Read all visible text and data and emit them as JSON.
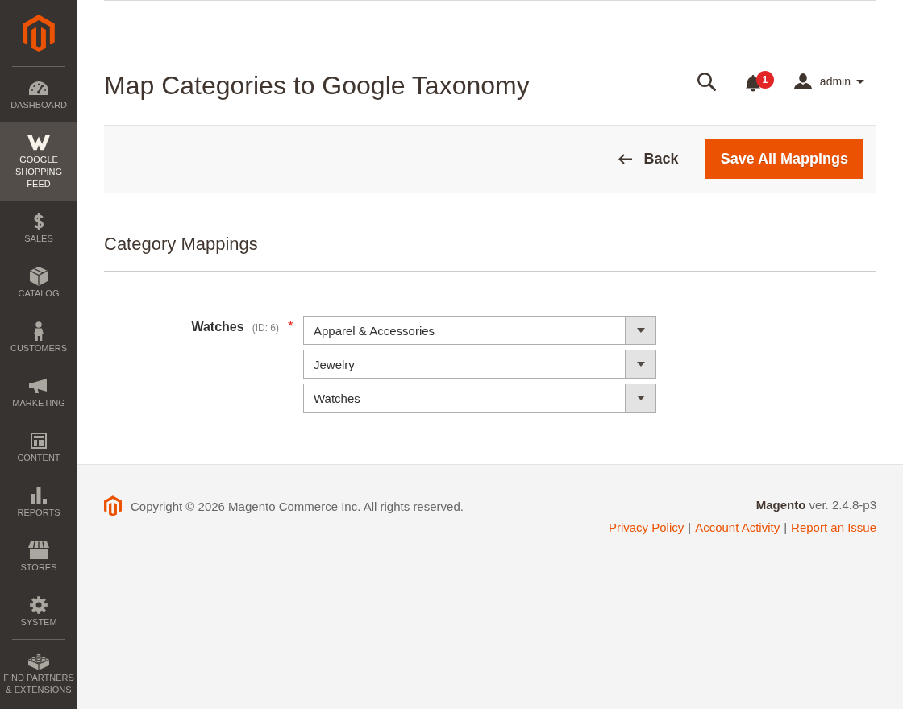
{
  "sidebar": {
    "items": [
      {
        "label": "DASHBOARD",
        "selected": false
      },
      {
        "label": "GOOGLE SHOPPING FEED",
        "selected": true
      },
      {
        "label": "SALES",
        "selected": false
      },
      {
        "label": "CATALOG",
        "selected": false
      },
      {
        "label": "CUSTOMERS",
        "selected": false
      },
      {
        "label": "MARKETING",
        "selected": false
      },
      {
        "label": "CONTENT",
        "selected": false
      },
      {
        "label": "REPORTS",
        "selected": false
      },
      {
        "label": "STORES",
        "selected": false
      },
      {
        "label": "SYSTEM",
        "selected": false
      },
      {
        "label": "FIND PARTNERS & EXTENSIONS",
        "selected": false
      }
    ]
  },
  "header": {
    "title": "Map Categories to Google Taxonomy",
    "notifications": {
      "count": "1"
    },
    "user": {
      "name": "admin"
    }
  },
  "actions": {
    "back_button": {
      "label": "Back"
    },
    "save_button": {
      "label": "Save All Mappings"
    }
  },
  "category_mappings": {
    "title": "Category Mappings",
    "fields": [
      {
        "label": "Watches",
        "note": "(ID: 6)",
        "required_mark": "*",
        "selects": [
          {
            "value": "Apparel & Accessories"
          },
          {
            "value": "Jewelry"
          },
          {
            "value": "Watches"
          }
        ]
      }
    ]
  },
  "footer": {
    "copyright": "Copyright © 2026 Magento Commerce Inc. All rights reserved.",
    "version": "**Magento** ver. 2.4.8-p3",
    "links": [
      {
        "kind": "link",
        "text": "Privacy Policy"
      },
      {
        "kind": "separator",
        "text": "|"
      },
      {
        "kind": "link",
        "text": "Account Activity"
      },
      {
        "kind": "separator",
        "text": "|"
      },
      {
        "kind": "link",
        "text": "Report an Issue"
      }
    ]
  }
}
